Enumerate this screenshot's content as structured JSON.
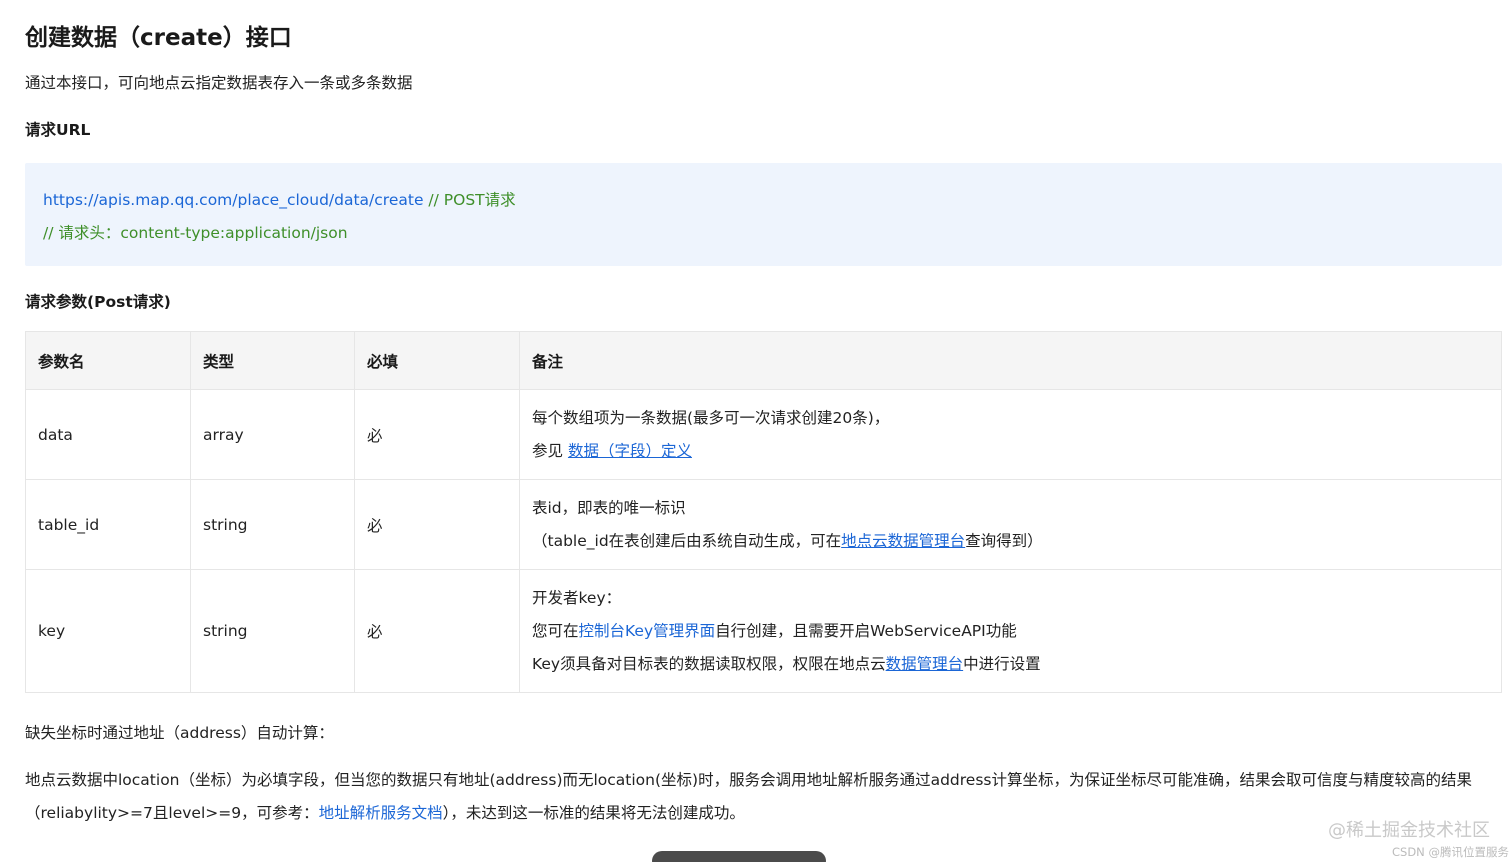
{
  "title": "创建数据（create）接口",
  "intro": "通过本接口，可向地点云指定数据表存入一条或多条数据",
  "request_url": {
    "heading": "请求URL",
    "url": "https://apis.map.qq.com/place_cloud/data/create",
    "url_comment": "// POST请求",
    "header_comment": "// 请求头：content-type:application/json"
  },
  "params": {
    "heading": "请求参数(Post请求)",
    "headers": [
      "参数名",
      "类型",
      "必填",
      "备注"
    ],
    "rows": [
      {
        "name": "data",
        "type": "array",
        "required": "必",
        "note_line1": "每个数组项为一条数据(最多可一次请求创建20条)，",
        "note_line2_prefix": "参见 ",
        "note_line2_link": "数据（字段）定义"
      },
      {
        "name": "table_id",
        "type": "string",
        "required": "必",
        "note_line1": "表id，即表的唯一标识",
        "note_line2_prefix": "（table_id在表创建后由系统自动生成，可在",
        "note_line2_link": "地点云数据管理台",
        "note_line2_suffix": "查询得到）"
      },
      {
        "name": "key",
        "type": "string",
        "required": "必",
        "note_line1": "开发者key：",
        "note_line2_prefix": "您可在",
        "note_line2_link": "控制台Key管理界面",
        "note_line2_suffix": "自行创建，且需要开启WebServiceAPI功能",
        "note_line3_prefix": "Key须具备对目标表的数据读取权限，权限在地点云",
        "note_line3_link": "数据管理台",
        "note_line3_suffix": "中进行设置"
      }
    ]
  },
  "bottom": {
    "line1": "缺失坐标时通过地址（address）自动计算：",
    "para_prefix": "地点云数据中location（坐标）为必填字段，但当您的数据只有地址(address)而无location(坐标)时，服务会调用地址解析服务通过address计算坐标，为保证坐标尽可能准确，结果会取可信度与精度较高的结果（reliabylity>=7且level>=9，可参考：",
    "para_link": "地址解析服务文档",
    "para_suffix": "），未达到这一标准的结果将无法创建成功。"
  },
  "watermarks": {
    "juejin": "@稀土掘金技术社区",
    "csdn": "CSDN @腾讯位置服务"
  },
  "colors": {
    "link": "#1b66d6",
    "comment": "#3f8f2a",
    "code_bg": "#eef4fd"
  }
}
